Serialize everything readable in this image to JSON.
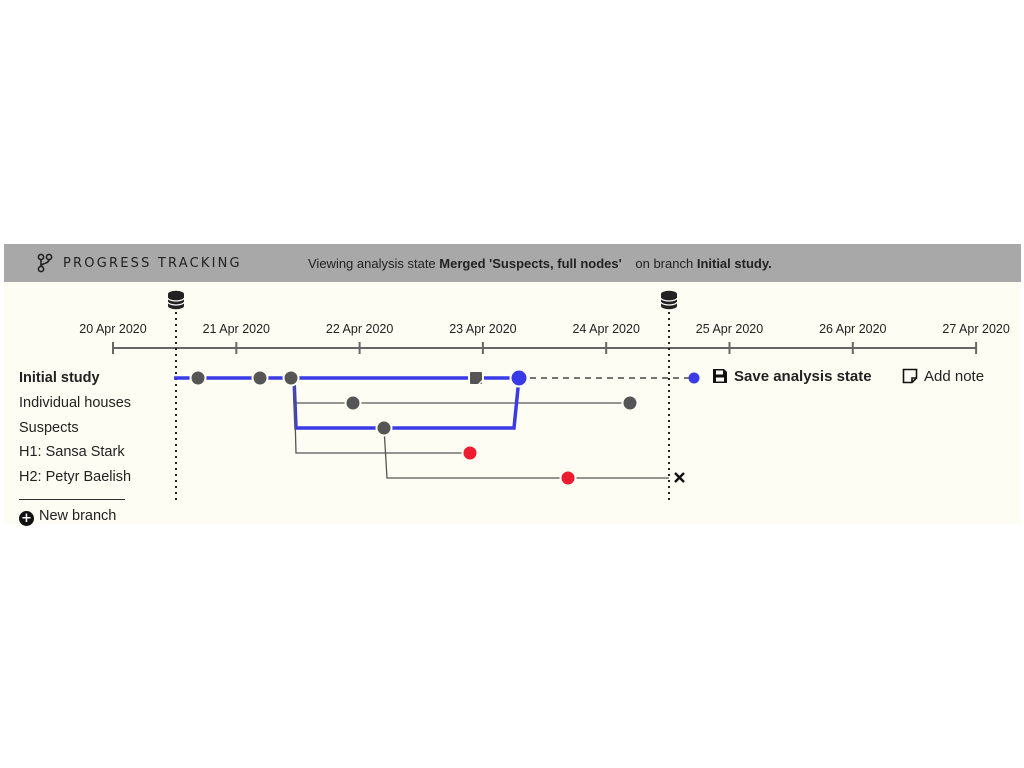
{
  "header": {
    "title": "PROGRESS TRACKING",
    "status_prefix": "Viewing analysis state",
    "state_name": "Merged 'Suspects, full nodes'",
    "branch_prefix": "on branch",
    "branch_name": "Initial study.",
    "icon": "branch-icon"
  },
  "timeline": {
    "dates": [
      "20 Apr 2020",
      "21 Apr 2020",
      "22 Apr 2020",
      "23 Apr 2020",
      "24 Apr 2020",
      "25 Apr 2020",
      "26 Apr 2020",
      "27 Apr 2020"
    ]
  },
  "branches": [
    {
      "label": "Initial study",
      "active": true
    },
    {
      "label": "Individual houses",
      "active": false
    },
    {
      "label": "Suspects",
      "active": false
    },
    {
      "label": "H1: Sansa Stark",
      "active": false
    },
    {
      "label": "H2: Petyr Baelish",
      "active": false
    }
  ],
  "new_branch_label": "New branch",
  "actions": {
    "save_label": "Save analysis state",
    "note_label": "Add note"
  },
  "colors": {
    "active": "#3a3ae8",
    "node": "#555555",
    "hypothesis": "#ee1c2e",
    "header_bg": "#a8a8a8",
    "panel_bg": "#fdfdf3"
  }
}
